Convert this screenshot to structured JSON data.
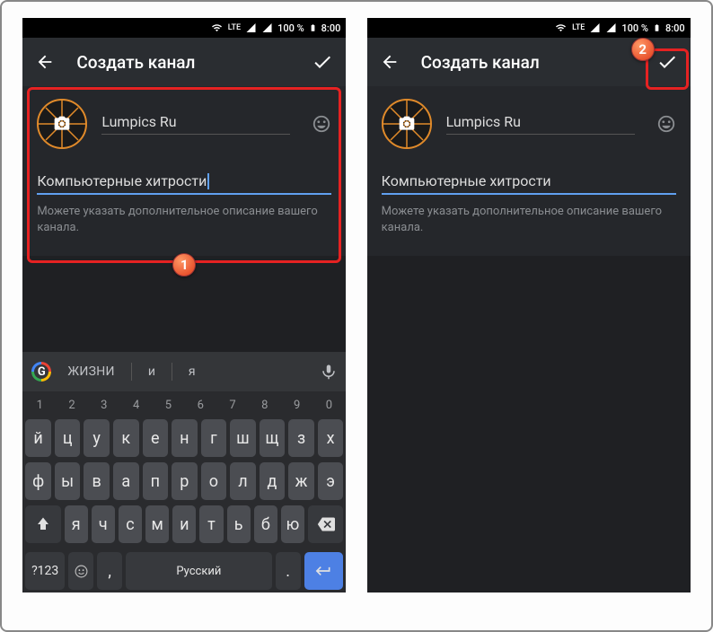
{
  "status": {
    "battery": "100 %",
    "time": "8:00",
    "lte": "LTE"
  },
  "appbar": {
    "title": "Создать канал"
  },
  "form": {
    "name_value": "Lumpics Ru",
    "desc_value": "Компьютерные хитрости",
    "helper": "Можете указать дополнительное описание вашего канала."
  },
  "badges": {
    "one": "1",
    "two": "2"
  },
  "kb": {
    "sug1": "жизни",
    "sug2": "и",
    "sug3": "я",
    "nums": [
      "1",
      "2",
      "3",
      "4",
      "5",
      "6",
      "7",
      "8",
      "9",
      "0"
    ],
    "row1": [
      "й",
      "ц",
      "у",
      "к",
      "е",
      "н",
      "г",
      "ш",
      "щ",
      "з",
      "х"
    ],
    "row2": [
      "ф",
      "ы",
      "в",
      "а",
      "п",
      "р",
      "о",
      "л",
      "д",
      "ж",
      "э"
    ],
    "row3": [
      "я",
      "ч",
      "с",
      "м",
      "и",
      "т",
      "ь",
      "б",
      "ю"
    ],
    "sym": "?123",
    "lang": "Русский",
    "dot": "."
  }
}
